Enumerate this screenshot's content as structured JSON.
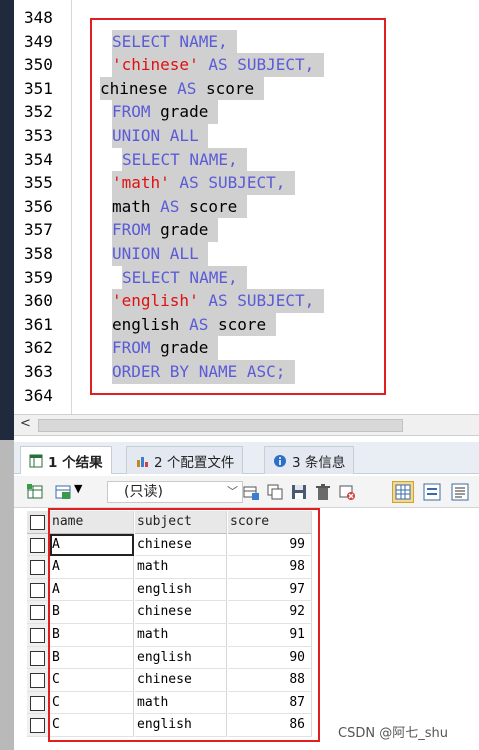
{
  "editor": {
    "top_cut_text": ");",
    "line_numbers": [
      "348",
      "349",
      "350",
      "351",
      "352",
      "353",
      "354",
      "355",
      "356",
      "357",
      "358",
      "359",
      "360",
      "361",
      "362",
      "363",
      "364"
    ],
    "lines": [
      [],
      [
        {
          "t": "SELECT NAME,",
          "c": "kw"
        }
      ],
      [
        {
          "t": "'chinese'",
          "c": "str"
        },
        {
          "t": " AS SUBJECT,",
          "c": "kw"
        }
      ],
      [
        {
          "t": "chinese ",
          "c": "id"
        },
        {
          "t": "AS",
          "c": "kw"
        },
        {
          "t": " score",
          "c": "id"
        }
      ],
      [
        {
          "t": "FROM",
          "c": "kw"
        },
        {
          "t": " grade",
          "c": "id"
        }
      ],
      [
        {
          "t": "UNION ALL",
          "c": "kw"
        }
      ],
      [
        {
          "t": "SELECT NAME,",
          "c": "kw"
        }
      ],
      [
        {
          "t": "'math'",
          "c": "str"
        },
        {
          "t": " AS SUBJECT,",
          "c": "kw"
        }
      ],
      [
        {
          "t": "math ",
          "c": "id"
        },
        {
          "t": "AS",
          "c": "kw"
        },
        {
          "t": " score",
          "c": "id"
        }
      ],
      [
        {
          "t": "FROM",
          "c": "kw"
        },
        {
          "t": " grade",
          "c": "id"
        }
      ],
      [
        {
          "t": "UNION ALL",
          "c": "kw"
        }
      ],
      [
        {
          "t": "SELECT NAME,",
          "c": "kw"
        }
      ],
      [
        {
          "t": "'english'",
          "c": "str"
        },
        {
          "t": " AS SUBJECT,",
          "c": "kw"
        }
      ],
      [
        {
          "t": "english ",
          "c": "id"
        },
        {
          "t": "AS",
          "c": "kw"
        },
        {
          "t": " score",
          "c": "id"
        }
      ],
      [
        {
          "t": "FROM",
          "c": "kw"
        },
        {
          "t": " grade",
          "c": "id"
        }
      ],
      [
        {
          "t": "ORDER BY NAME ASC;",
          "c": "kw"
        }
      ],
      []
    ]
  },
  "scrollbar": {
    "left_arrow": "<"
  },
  "tabs": [
    {
      "label": "1 个结果",
      "icon": "result-table-icon",
      "active": true
    },
    {
      "label": "2 个配置文件",
      "icon": "profile-icon",
      "active": false
    },
    {
      "label": "3 条信息",
      "icon": "info-icon",
      "active": false
    }
  ],
  "toolbar": {
    "readonly_select": "(只读)",
    "icons": [
      "grid-export-icon",
      "grid-options-icon",
      "dropdown-arrow-icon",
      "add-row-icon",
      "copy-row-icon",
      "save-icon",
      "delete-icon",
      "refresh-icon",
      "grid-view-icon",
      "form-view-icon",
      "text-view-icon"
    ]
  },
  "grid": {
    "columns": [
      "name",
      "subject",
      "score"
    ],
    "rows": [
      [
        "A",
        "chinese",
        "99"
      ],
      [
        "A",
        "math",
        "98"
      ],
      [
        "A",
        "english",
        "97"
      ],
      [
        "B",
        "chinese",
        "92"
      ],
      [
        "B",
        "math",
        "91"
      ],
      [
        "B",
        "english",
        "90"
      ],
      [
        "C",
        "chinese",
        "88"
      ],
      [
        "C",
        "math",
        "87"
      ],
      [
        "C",
        "english",
        "86"
      ]
    ]
  },
  "watermark": "CSDN @阿七_shu",
  "colors": {
    "keyword": "#5b5bd8",
    "string": "#e01010",
    "selection": "#d0d0d0",
    "highlight_box": "#e02020",
    "left_strip": "#1f2b3c"
  }
}
